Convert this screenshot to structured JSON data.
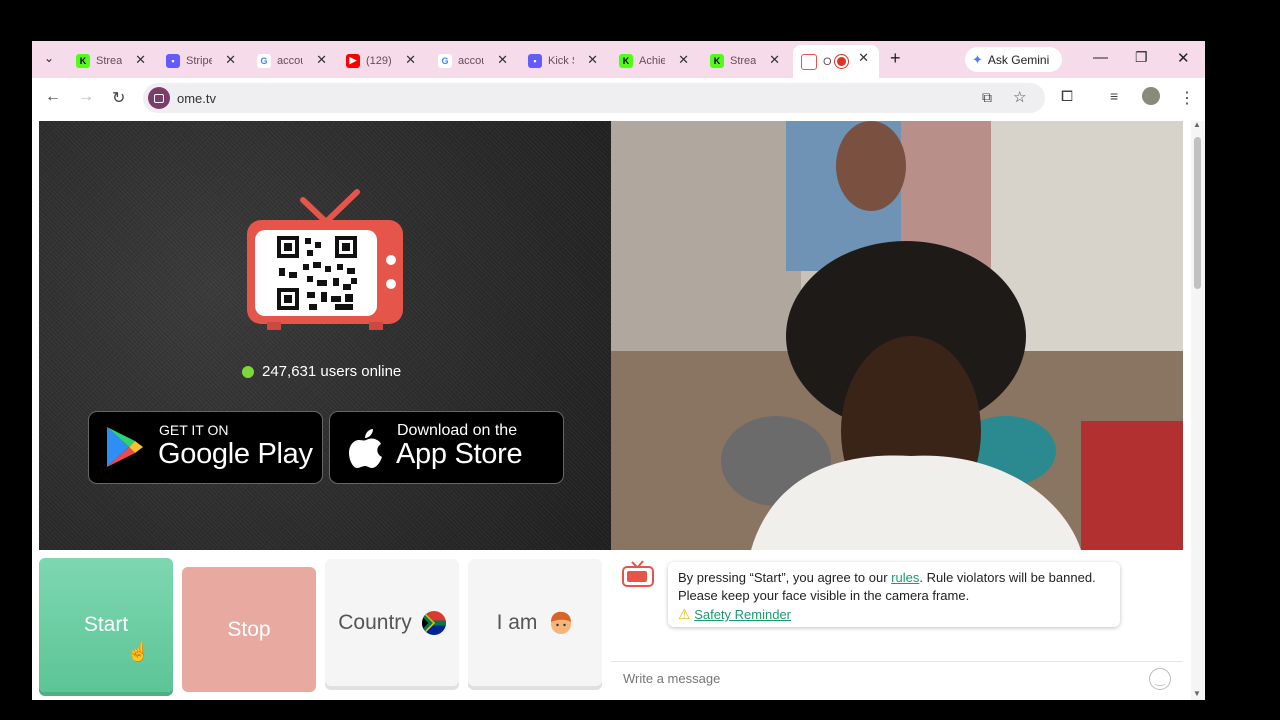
{
  "tabs": [
    {
      "title": "Strea",
      "favicon": "kick-icon",
      "color": "#53fc18"
    },
    {
      "title": "Stripe",
      "favicon": "stripe-icon",
      "color": "#635bff"
    },
    {
      "title": "accou",
      "favicon": "google-icon",
      "color": "#4285f4"
    },
    {
      "title": "(129)",
      "favicon": "youtube-icon",
      "color": "#ff0000"
    },
    {
      "title": "accou",
      "favicon": "google-icon",
      "color": "#4285f4"
    },
    {
      "title": "Kick S",
      "favicon": "stripe-icon",
      "color": "#635bff"
    },
    {
      "title": "Achie",
      "favicon": "kick-icon",
      "color": "#53fc18"
    },
    {
      "title": "Strea",
      "favicon": "kick-icon",
      "color": "#53fc18"
    },
    {
      "title": "O",
      "favicon": "ometv-icon",
      "color": "#e5554a"
    }
  ],
  "gemini_label": "Ask Gemini",
  "url": "ome.tv",
  "online_text": "247,631 users online",
  "google_play": {
    "small": "GET IT ON",
    "big": "Google Play"
  },
  "app_store": {
    "small": "Download on the",
    "big": "App Store"
  },
  "buttons": {
    "start": "Start",
    "stop": "Stop",
    "country": "Country",
    "iam": "I am"
  },
  "notice": {
    "prefix": "By pressing “Start”, you agree to our ",
    "rules_link": "rules",
    "suffix": ". Rule violators will be banned. Please keep your face visible in the camera frame.",
    "safety_link": "Safety Reminder"
  },
  "message_placeholder": "Write a message",
  "colors": {
    "accent_green": "#5cc596",
    "stop_red": "#e7a9a0",
    "online_dot": "#7cd83a",
    "brand": "#e5554a"
  }
}
